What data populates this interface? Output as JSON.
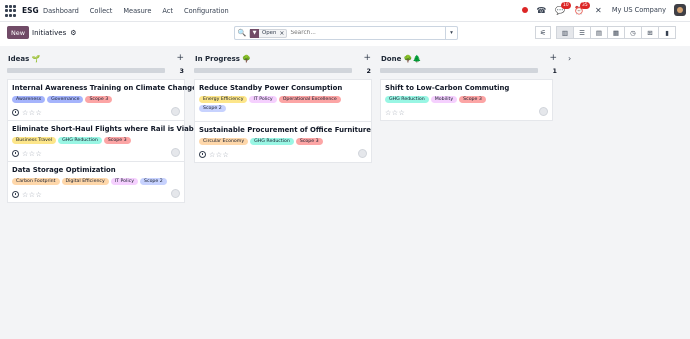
{
  "navbar": {
    "app_name": "ESG",
    "menu": [
      "Dashboard",
      "Collect",
      "Measure",
      "Act",
      "Configuration"
    ],
    "chat_badge": "10",
    "activity_badge": "35",
    "company": "My US Company"
  },
  "control": {
    "new_label": "New",
    "breadcrumb": "Initiatives",
    "facet_label": "Open",
    "search_placeholder": "Search..."
  },
  "columns": [
    {
      "title": "Ideas 🌱",
      "count": "3",
      "progress": 0,
      "cards": [
        {
          "title": "Internal Awareness Training on Climate Change",
          "tags": [
            {
              "label": "Awareness",
              "color": "#a5b4fc"
            },
            {
              "label": "Governance",
              "color": "#a5b4fc"
            },
            {
              "label": "Scope 3",
              "color": "#fca5a5"
            }
          ]
        },
        {
          "title": "Eliminate Short-Haul Flights where Rail is Viable",
          "tags": [
            {
              "label": "Business Travel",
              "color": "#fde68a"
            },
            {
              "label": "GHG Reduction",
              "color": "#99f6e4"
            },
            {
              "label": "Scope 3",
              "color": "#fca5a5"
            }
          ]
        },
        {
          "title": "Data Storage Optimization",
          "tags": [
            {
              "label": "Carbon Footprint",
              "color": "#fed7aa"
            },
            {
              "label": "Digital Efficiency",
              "color": "#fed7aa"
            },
            {
              "label": "IT Policy",
              "color": "#f5d0fe"
            },
            {
              "label": "Scope 2",
              "color": "#c7d2fe"
            }
          ]
        }
      ]
    },
    {
      "title": "In Progress 🌳",
      "count": "2",
      "progress": 0,
      "cards": [
        {
          "title": "Reduce Standby Power Consumption",
          "tags": [
            {
              "label": "Energy Efficiency",
              "color": "#fde68a"
            },
            {
              "label": "IT Policy",
              "color": "#f5d0fe"
            },
            {
              "label": "Operational Excellence",
              "color": "#fca5a5"
            },
            {
              "label": "Scope 2",
              "color": "#c7d2fe"
            }
          ]
        },
        {
          "title": "Sustainable Procurement of Office Furniture",
          "tags": [
            {
              "label": "Circular Economy",
              "color": "#fed7aa"
            },
            {
              "label": "GHG Reduction",
              "color": "#99f6e4"
            },
            {
              "label": "Scope 3",
              "color": "#fca5a5"
            }
          ]
        }
      ]
    },
    {
      "title": "Done 🌳🌲",
      "count": "1",
      "progress": 0,
      "cards": [
        {
          "title": "Shift to Low-Carbon Commuting",
          "tags": [
            {
              "label": "GHG Reduction",
              "color": "#99f6e4"
            },
            {
              "label": "Mobility",
              "color": "#f5d0fe"
            },
            {
              "label": "Scope 3",
              "color": "#fca5a5"
            }
          ]
        }
      ]
    }
  ],
  "colors": {
    "brand": "#714b67",
    "badge": "#dc2626"
  }
}
